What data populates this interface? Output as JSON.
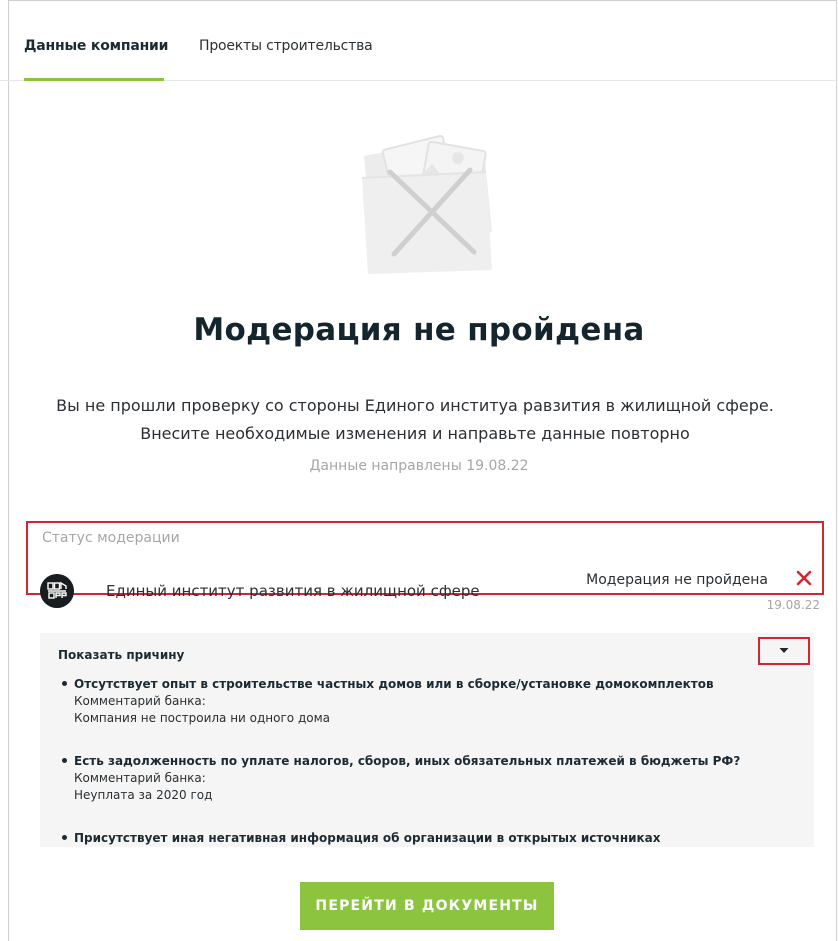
{
  "tabs": [
    {
      "label": "Данные компании",
      "active": true
    },
    {
      "label": "Проекты строительства",
      "active": false
    }
  ],
  "illustration_icon": "empty-folder-crossed-icon",
  "title": "Модерация не пройдена",
  "description": "Вы не прошли проверку со стороны Единого институа равзития в жилищной сфере. Внесите необходимые изменения и направьте данные повторно",
  "sent_text": "Данные направлены 19.08.22",
  "moderation": {
    "section_label": "Статус модерации",
    "org_logo_icon": "dom-rf-logo-icon",
    "org_name": "Единый институт развития в жилищной сфере",
    "status": "Модерация не пройдена",
    "status_icon": "close-x-icon",
    "date": "19.08.22"
  },
  "reasons": {
    "toggle_label": "Показать причину",
    "toggle_icon": "caret-down-icon",
    "items": [
      {
        "title": "Отсутствует опыт в строительстве частных домов или в сборке/установке домокомплектов",
        "comment_label": "Комментарий банка:",
        "comment": "Компания не построила ни одного дома"
      },
      {
        "title": "Есть задолженность по уплате налогов, сборов, иных обязательных платежей в бюджеты РФ?",
        "comment_label": "Комментарий банка:",
        "comment": "Неуплата за 2020 год"
      },
      {
        "title": "Присутствует иная негативная информация об организации в открытых источниках",
        "comment_label": "",
        "comment": ""
      }
    ]
  },
  "cta_label": "ПЕРЕЙТИ В ДОКУМЕНТЫ",
  "colors": {
    "accent_green": "#8cc43f",
    "error_red": "#d62532",
    "muted_gray": "#a6a6a6",
    "panel_bg": "#f5f5f5"
  }
}
